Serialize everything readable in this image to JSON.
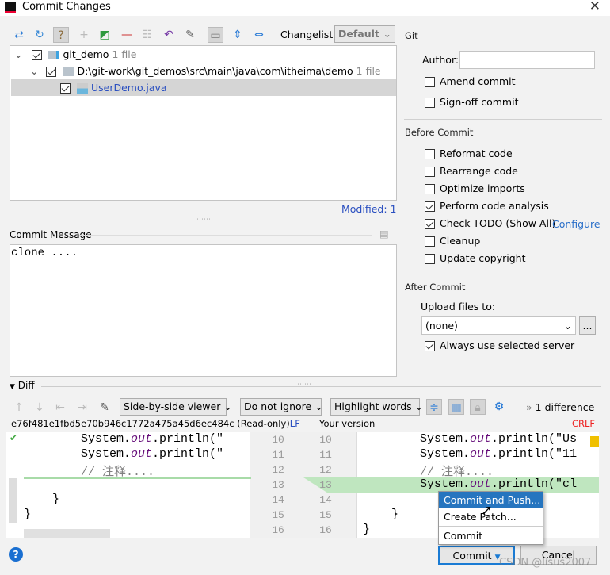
{
  "window": {
    "title": "Commit Changes",
    "close": "✕"
  },
  "toolbar": {
    "changelist_label": "Changelist:",
    "changelist_value": "Default"
  },
  "tree": {
    "items": [
      {
        "name": "git_demo",
        "count": "1 file",
        "checked": true
      },
      {
        "name": "D:\\git-work\\git_demos\\src\\main\\java\\com\\itheima\\demo",
        "count": "1 file",
        "checked": true
      },
      {
        "name": "UserDemo.java",
        "checked": true
      }
    ],
    "modified": "Modified: 1"
  },
  "commit_message": {
    "label": "Commit Message",
    "value": "clone ...."
  },
  "git": {
    "heading": "Git",
    "author_label": "Author:",
    "author_value": "",
    "amend": "Amend commit",
    "signoff": "Sign-off commit"
  },
  "before_commit": {
    "heading": "Before Commit",
    "items": [
      {
        "label": "Reformat code",
        "checked": false
      },
      {
        "label": "Rearrange code",
        "checked": false
      },
      {
        "label": "Optimize imports",
        "checked": false
      },
      {
        "label": "Perform code analysis",
        "checked": true
      },
      {
        "label": "Check TODO (Show All)",
        "checked": true
      },
      {
        "label": "Cleanup",
        "checked": false
      },
      {
        "label": "Update copyright",
        "checked": false
      }
    ],
    "configure": "Configure"
  },
  "after_commit": {
    "heading": "After Commit",
    "upload_label": "Upload files to:",
    "upload_value": "(none)",
    "browse": "...",
    "always_use": "Always use selected server"
  },
  "diff": {
    "label": "Diff",
    "viewer": "Side-by-side viewer",
    "ignore": "Do not ignore",
    "highlight": "Highlight words",
    "differences": "1 difference",
    "left_header": "e76f481e1fbd5e70b946c1772a475a45d6ec484c (Read-only)",
    "left_eol": "LF",
    "right_header": "Your version",
    "right_eol": "CRLF",
    "line_numbers": [
      "10",
      "11",
      "12",
      "13",
      "14",
      "15",
      "16"
    ],
    "left_lines": [
      "        System.out.println(\"",
      "        System.out.println(\"",
      "        // 注释....",
      "",
      "    }",
      "}",
      ""
    ],
    "right_lines": [
      "        System.out.println(\"Us",
      "        System.out.println(\"11",
      "        // 注释....",
      "        System.out.println(\"cl",
      "",
      "    }",
      "}"
    ]
  },
  "menu": {
    "items": [
      "Commit and Push...",
      "Create Patch...",
      "Commit"
    ]
  },
  "buttons": {
    "help": "?",
    "commit": "Commit",
    "cancel": "Cancel"
  },
  "watermark": "CSDN @lisus2007"
}
